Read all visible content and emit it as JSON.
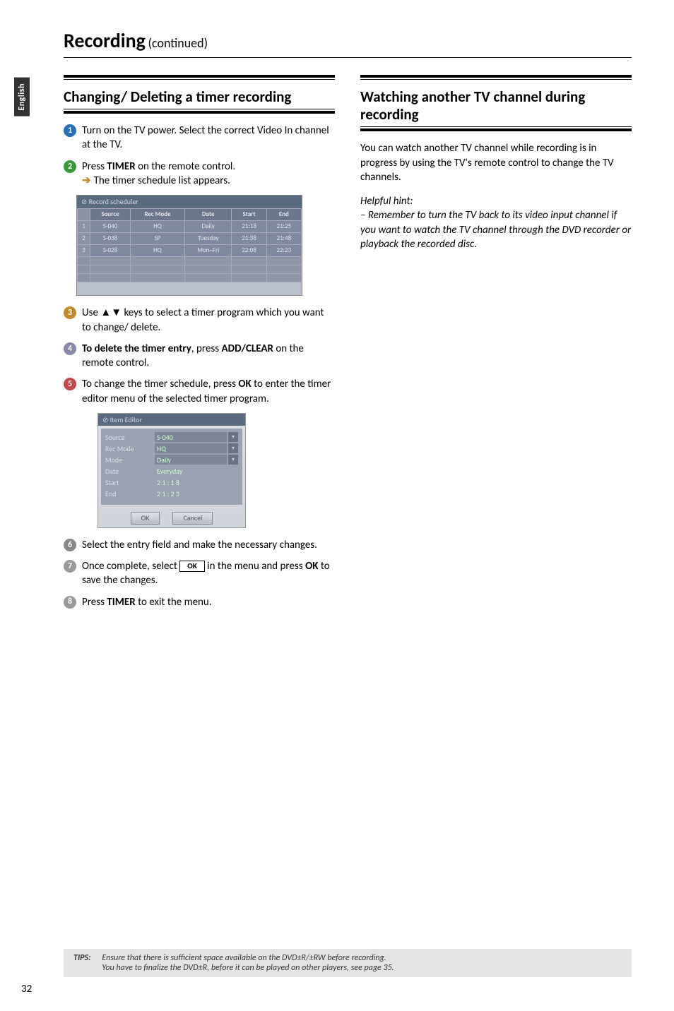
{
  "sideTab": "English",
  "pageTitle": "Recording",
  "pageTitleSub": "(continued)",
  "left": {
    "heading": "Changing/ Deleting a timer recording",
    "step1": "Turn on the TV power. Select the correct Video In channel at the TV.",
    "step2_pre": "Press ",
    "step2_b": "TIMER",
    "step2_post": " on the remote control.",
    "step2_arrow": "The timer schedule list appears.",
    "sched": {
      "title": "Record scheduler",
      "headers": [
        "",
        "Source",
        "Rec Mode",
        "Date",
        "Start",
        "End"
      ],
      "rows": [
        [
          "1",
          "S-040",
          "HQ",
          "Daily",
          "21:18",
          "21:25"
        ],
        [
          "2",
          "S-038",
          "SP",
          "Tuesday",
          "21:38",
          "21:48"
        ],
        [
          "3",
          "S-028",
          "HQ",
          "Mon~Fri",
          "22:08",
          "22:23"
        ]
      ]
    },
    "step3_pre": "Use ",
    "step3_keys": "▲▼",
    "step3_post": " keys to select a timer program which you want to change/ delete.",
    "step4_b1": "To delete the timer entry",
    "step4_mid": ", press ",
    "step4_b2": "ADD/CLEAR",
    "step4_post": " on the remote control.",
    "step5_pre": "To change the timer schedule, press ",
    "step5_b": "OK",
    "step5_post": " to enter the timer editor menu of the selected timer program.",
    "editor": {
      "title": "Item Editor",
      "rows": [
        {
          "label": "Source",
          "val": "S-040",
          "dd": true
        },
        {
          "label": "Rec Mode",
          "val": "HQ",
          "dd": true
        },
        {
          "label": "Mode",
          "val": "Daily",
          "dd": true
        },
        {
          "label": "Date",
          "val": "Everyday",
          "dd": false
        },
        {
          "label": "Start",
          "val": "2  1  :  1  8",
          "dd": false
        },
        {
          "label": "End",
          "val": "2  1  :  2  3",
          "dd": false
        }
      ],
      "ok": "OK",
      "cancel": "Cancel"
    },
    "step6": "Select the entry field and make the necessary changes.",
    "step7_pre": "Once complete, select ",
    "step7_ok": "OK",
    "step7_mid": " in the menu and press ",
    "step7_b": "OK",
    "step7_post": " to save the changes.",
    "step8_pre": "Press ",
    "step8_b": "TIMER",
    "step8_post": " to exit the menu."
  },
  "right": {
    "heading": "Watching another TV channel during recording",
    "para1": "You can watch another TV channel while recording is in progress by using the TV's remote control to change the TV channels.",
    "hintLabel": "Helpful hint:",
    "hintBody": "– Remember to turn the TV back to its video input channel if you want to watch the TV channel through the DVD recorder or playback the recorded disc."
  },
  "tips": {
    "label": "TIPS:",
    "line1": "Ensure that there is sufficient space available on the DVD±R/±RW before recording.",
    "line2": "You have to finalize the DVD±R, before it can be played on other players, see page 35."
  },
  "pageNumber": "32"
}
